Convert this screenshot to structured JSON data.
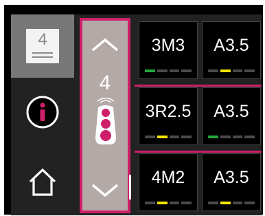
{
  "tool_panel": {
    "items": [
      {
        "name": "tool-number",
        "number": "4",
        "active": true
      },
      {
        "name": "info",
        "icon": "info-icon"
      },
      {
        "name": "home",
        "icon": "home-icon"
      }
    ]
  },
  "selector": {
    "value": "4",
    "up_icon": "chevron-up-icon",
    "down_icon": "chevron-down-icon",
    "indicator_icon": "traffic-light-icon"
  },
  "grid": {
    "rows": [
      {
        "cells": [
          {
            "label": "3M3",
            "bars": [
              "green",
              "off",
              "off",
              "off"
            ]
          },
          {
            "label": "A3.5",
            "bars": [
              "off",
              "yellow",
              "off",
              "off"
            ]
          }
        ]
      },
      {
        "cells": [
          {
            "label": "3R2.5",
            "bars": [
              "off",
              "yellow",
              "off",
              "off"
            ]
          },
          {
            "label": "A3.5",
            "bars": [
              "green",
              "off",
              "off",
              "off"
            ]
          }
        ]
      },
      {
        "cells": [
          {
            "label": "4M2",
            "bars": [
              "off",
              "yellow",
              "off",
              "off"
            ]
          },
          {
            "label": "A3.5",
            "bars": [
              "off",
              "yellow",
              "off",
              "off"
            ]
          }
        ]
      }
    ]
  },
  "colors": {
    "accent": "#cf1f6a",
    "green": "#24a83c",
    "yellow": "#f2e400",
    "selector_bg": "#b3a9a7"
  }
}
